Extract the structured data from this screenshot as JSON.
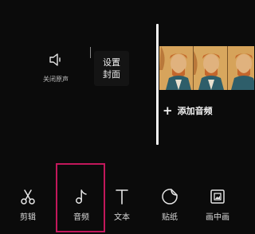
{
  "editor": {
    "mute_label": "关闭原声",
    "cover_line1": "设置",
    "cover_line2": "封面",
    "add_audio_plus": "+",
    "add_audio_label": "添加音频"
  },
  "toolbar": {
    "items": [
      {
        "label": "剪辑",
        "icon": "scissors-icon"
      },
      {
        "label": "音频",
        "icon": "music-note-icon"
      },
      {
        "label": "文本",
        "icon": "text-icon"
      },
      {
        "label": "贴纸",
        "icon": "sticker-icon"
      },
      {
        "label": "画中画",
        "icon": "picture-in-picture-icon"
      }
    ],
    "highlighted": "音频"
  },
  "colors": {
    "background": "#0b0b0b",
    "highlight": "#c2185b",
    "text": "#e6e6e6"
  }
}
